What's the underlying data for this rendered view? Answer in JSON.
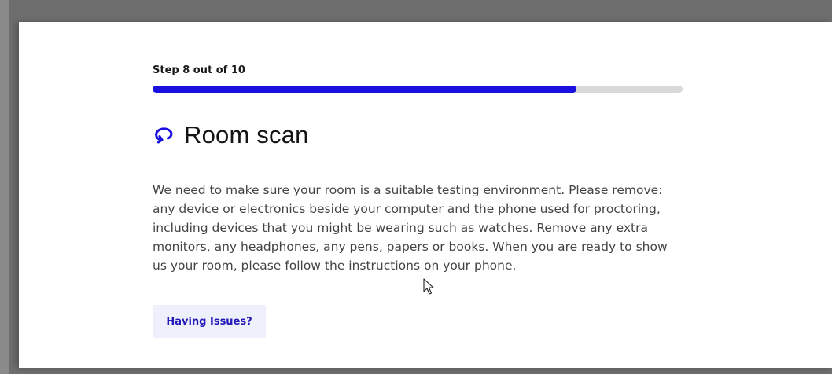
{
  "progress": {
    "step_label": "Step 8 out of 10",
    "current_step": 8,
    "total_steps": 10,
    "fill_fraction": 0.8,
    "fill_color": "#1a10e0",
    "track_color": "#d9d9d9"
  },
  "header": {
    "title": "Room scan",
    "icon": "rotate-scan-icon",
    "icon_color": "#1a10e0"
  },
  "main": {
    "instructions": "We need to make sure your room is a suitable testing environment. Please remove: any device or electronics beside your computer and the phone used for proctoring, including devices that you might be wearing such as watches. Remove any extra monitors, any headphones, any pens, papers or books. When you are ready to show us your room, please follow the instructions on your phone."
  },
  "actions": {
    "issues_label": "Having Issues?"
  },
  "pointer": {
    "icon": "mouse-pointer-icon"
  }
}
